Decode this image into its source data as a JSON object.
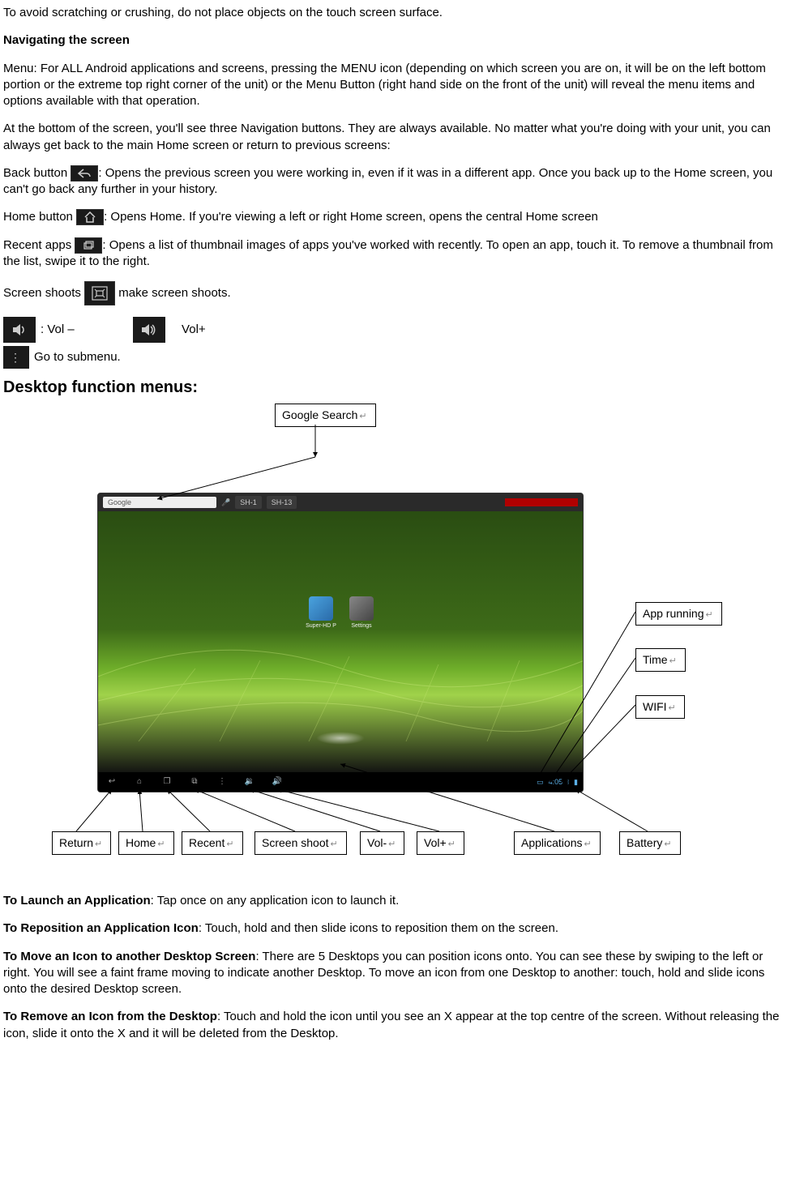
{
  "intro": {
    "scratch_warning": "To avoid scratching or crushing, do not place objects on the touch screen surface.",
    "nav_heading": "Navigating the screen",
    "menu_para": "Menu: For ALL Android applications and screens, pressing the MENU icon (depending on which screen you are on, it will be on the left bottom portion or the extreme top right corner of the unit) or the Menu Button (right hand side on the front of the unit) will reveal the menu items and options available with that operation.",
    "bottom_para": "At the bottom of the screen, you'll see three Navigation buttons. They are always available. No matter what you're doing with your unit, you can always get back to the main Home screen or return to previous screens:"
  },
  "buttons": {
    "back_label": "Back button ",
    "back_text": ": Opens the previous screen you were working in, even if it was in a different app. Once you back up to the Home screen, you can't go back any further in your history.",
    "home_label": "Home button ",
    "home_text": ": Opens Home. If you're viewing a left or right Home screen, opens the central Home screen",
    "recent_label": "Recent apps ",
    "recent_text": ": Opens a list of thumbnail images of apps you've worked with recently. To open an app, touch it. To remove a thumbnail from the list, swipe it to the right.",
    "screenshot_label": "Screen shoots ",
    "screenshot_text": " make screen shoots.",
    "vol_minus": ": Vol –",
    "vol_plus": "Vol+",
    "submenu": " Go to submenu."
  },
  "section_heading": "Desktop function menus:",
  "diagram": {
    "google_search": "Google Search",
    "app_running": "App running",
    "time": "Time",
    "wifi": "WIFI",
    "return": "Return",
    "home": "Home",
    "recent": "Recent",
    "screenshoot": "Screen shoot",
    "vol_minus": "Vol-",
    "vol_plus": "Vol+",
    "applications": "Applications",
    "battery": "Battery",
    "tablet": {
      "google_label": "Google",
      "seg1": "SH-1",
      "seg2": "SH-13",
      "app1": "Super-HD P",
      "app2": "Settings",
      "clock": "4:05"
    }
  },
  "howto": {
    "launch_b": "To Launch an Application",
    "launch_t": ": Tap once on any application icon to launch it.",
    "repos_b": "To Reposition an Application Icon",
    "repos_t": ": Touch, hold and then slide icons to reposition them on the screen.",
    "move_b": "To Move an Icon to another Desktop Screen",
    "move_t": ": There are 5 Desktops you can position icons onto. You can see these by swiping to the left or right. You will see a faint frame moving to indicate another Desktop. To move an icon from one Desktop to another: touch, hold and slide icons onto the desired Desktop screen.",
    "remove_b": "To Remove an Icon from the Desktop",
    "remove_t": ": Touch and hold the icon until you see an X appear at the top centre of the screen. Without releasing the icon, slide it onto the X and it will be deleted from the Desktop."
  }
}
